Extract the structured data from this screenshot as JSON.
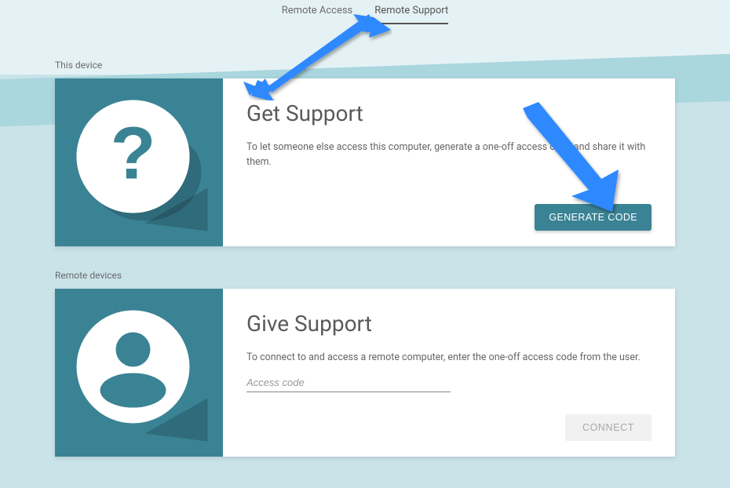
{
  "tabs": {
    "remote_access": "Remote Access",
    "remote_support": "Remote Support"
  },
  "sections": {
    "this_device_label": "This device",
    "remote_devices_label": "Remote devices"
  },
  "get_support": {
    "title": "Get Support",
    "description": "To let someone else access this computer, generate a one-off access code and share it with them.",
    "button": "GENERATE CODE"
  },
  "give_support": {
    "title": "Give Support",
    "description": "To connect to and access a remote computer, enter the one-off access code from the user.",
    "placeholder": "Access code",
    "button": "CONNECT"
  },
  "colors": {
    "teal": "#3a8395",
    "arrow": "#2e89ff"
  }
}
